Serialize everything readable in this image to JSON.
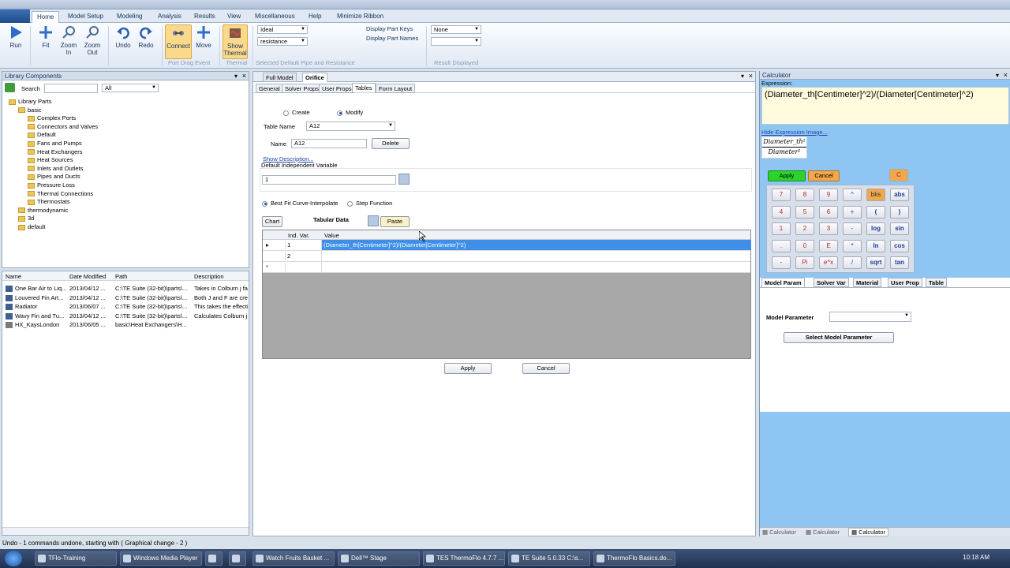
{
  "menu": {
    "tabs": [
      "Home",
      "Model Setup",
      "Modeling",
      "Analysis",
      "Results",
      "View",
      "Miscellaneous",
      "Help",
      "Minimize Ribbon"
    ]
  },
  "ribbon": {
    "buttons": [
      {
        "label": "Run",
        "icon": "play-icon"
      },
      {
        "label": "Fit",
        "icon": "fit-arrows-icon"
      },
      {
        "label": "Zoom In",
        "icon": "zoom-in-icon"
      },
      {
        "label": "Zoom Out",
        "icon": "zoom-out-icon"
      },
      {
        "label": "Undo",
        "icon": "undo-icon"
      },
      {
        "label": "Redo",
        "icon": "redo-icon"
      },
      {
        "label": "Connect",
        "icon": "connect-icon"
      },
      {
        "label": "Move",
        "icon": "move-icon"
      },
      {
        "label": "Show Thermal",
        "icon": "thermal-icon"
      }
    ],
    "groups": {
      "port_drag": "Port Drag Event",
      "thermal": "Thermal",
      "pipe": "Selected Default Pipe and Resistance",
      "result": "Result Displayed"
    },
    "pipe_combo": "Ideal",
    "resistance_combo": "resistance",
    "display_keys": "Display Part Keys",
    "display_names": "Display Part Names",
    "result_combo": "None"
  },
  "library": {
    "title": "Library Components",
    "search_label": "Search",
    "filter": "All",
    "tree": [
      {
        "label": "Library Parts",
        "level": 0
      },
      {
        "label": "basic",
        "level": 1
      },
      {
        "label": "Complex Ports",
        "level": 2
      },
      {
        "label": "Connectors and Valves",
        "level": 2
      },
      {
        "label": "Default",
        "level": 2
      },
      {
        "label": "Fans and Pumps",
        "level": 2
      },
      {
        "label": "Heat Exchangers",
        "level": 2
      },
      {
        "label": "Heat Sources",
        "level": 2
      },
      {
        "label": "Inlets and Outlets",
        "level": 2
      },
      {
        "label": "Pipes and Ducts",
        "level": 2
      },
      {
        "label": "Pressure Loss",
        "level": 2
      },
      {
        "label": "Thermal Connections",
        "level": 2
      },
      {
        "label": "Thermostats",
        "level": 2
      },
      {
        "label": "thermodynamic",
        "level": 1
      },
      {
        "label": "3d",
        "level": 1
      },
      {
        "label": "default",
        "level": 1
      }
    ],
    "columns": [
      "Name",
      "Date Modified",
      "Path",
      "Description"
    ],
    "rows": [
      {
        "name": "One Bar Air to Liq...",
        "date": "2013/04/12 ...",
        "path": "C:\\TE Suite (32-bit)\\parts\\...",
        "desc": "Takes in Colburn j fac"
      },
      {
        "name": "Louvered Fin Art...",
        "date": "2013/04/12 ...",
        "path": "C:\\TE Suite (32-bit)\\parts\\...",
        "desc": "Both J and F are crea"
      },
      {
        "name": "Radiator",
        "date": "2013/06/07 ...",
        "path": "C:\\TE Suite (32-bit)\\parts\\...",
        "desc": "This takes the effecti"
      },
      {
        "name": "Wavy Fin and Tu...",
        "date": "2013/04/12 ...",
        "path": "C:\\TE Suite (32-bit)\\parts\\...",
        "desc": "Calculates Colburn j fa"
      },
      {
        "name": "HX_KaysLondon",
        "date": "2013/06/05 ...",
        "path": "basic\\Heat Exchangers\\H...",
        "desc": ""
      }
    ]
  },
  "editor": {
    "doc_tabs": [
      "Full Model",
      "Orifice"
    ],
    "sub_tabs": [
      "General",
      "Solver Props",
      "User Props",
      "Tables",
      "Form Layout"
    ],
    "create": "Create",
    "modify": "Modify",
    "table_name_label": "Table Name",
    "table_name": "A12",
    "name_label": "Name",
    "name_value": "A12",
    "delete": "Delete",
    "show_desc": "Show Description...",
    "indep_label": "Default Independent Variable",
    "indep_value": "1",
    "best_fit": "Best Fit Curve-Interpolate",
    "step": "Step Function",
    "chart": "Chart",
    "tabular": "Tabular Data",
    "paste": "Paste",
    "grid_cols": [
      "Ind. Var.",
      "Value"
    ],
    "grid_rows": [
      {
        "marker": "▸",
        "ind": "1",
        "value": "(Diameter_th[Centimeter]^2)/(Diameter[Centimeter]^2)"
      },
      {
        "marker": "",
        "ind": "2",
        "value": ""
      },
      {
        "marker": "*",
        "ind": "",
        "value": ""
      }
    ],
    "apply": "Apply",
    "cancel": "Cancel"
  },
  "calculator": {
    "title": "Calculator",
    "expr_label": "Expression:",
    "expression": "(Diameter_th[Centimeter]^2)/(Diameter[Centimeter]^2)",
    "hide_link": "Hide Expression Image...",
    "img_num": "Diameter_th²",
    "img_den": "Diameter²",
    "apply": "Apply",
    "cancel": "Cancel",
    "clear": "C",
    "keys": [
      [
        "7",
        "8",
        "9",
        "^",
        "bks",
        "abs"
      ],
      [
        "4",
        "5",
        "6",
        "+",
        "(",
        ")"
      ],
      [
        "1",
        "2",
        "3",
        "-",
        "log",
        "sin"
      ],
      [
        ".",
        "0",
        "E",
        "*",
        "ln",
        "cos"
      ],
      [
        "-",
        "Pi",
        "e^x",
        "/",
        "sqrt",
        "tan"
      ]
    ],
    "tabs": [
      "Model Param",
      "Solver Var",
      "Material",
      "User Prop",
      "Table"
    ],
    "param_label": "Model Parameter",
    "select_btn": "Select Model Parameter",
    "bottom_tabs": [
      "Calculator",
      "Calculator",
      "Calculator"
    ]
  },
  "status": "Undo - 1 commands undone, starting with ( Graphical change - 2 )",
  "taskbar": {
    "items": [
      "TFlo-Training",
      "Windows Media Player",
      "",
      "",
      "Watch Fruits Basket ...",
      "Dell™ Stage",
      "TES ThermoFlo 4.7.7 ...",
      "TE Suite 5.0.33 C:\\s...",
      "ThermoFlo Basics.do..."
    ],
    "clock": "10:18 AM"
  }
}
